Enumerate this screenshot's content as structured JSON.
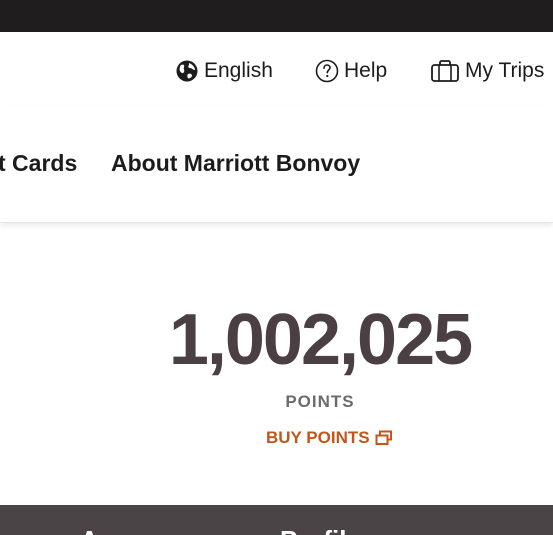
{
  "utility_nav": {
    "language": {
      "label": "English",
      "icon": "globe-icon"
    },
    "help": {
      "label": "Help",
      "icon": "question-circle-icon"
    },
    "trips": {
      "label": "My Trips",
      "icon": "suitcase-icon"
    }
  },
  "main_nav": {
    "items": [
      {
        "label": "t Cards"
      },
      {
        "label": "About Marriott Bonvoy"
      }
    ]
  },
  "points": {
    "value": "1,002,025",
    "label": "POINTS",
    "buy_label": "BUY POINTS",
    "buy_icon": "external-window-icon"
  },
  "bottom_band": {
    "left_text": "A",
    "right_text": "Profil"
  },
  "colors": {
    "top_strip": "#1f1d1e",
    "points_text": "#4a3f42",
    "accent": "#c2561a",
    "band": "#4b4447"
  }
}
